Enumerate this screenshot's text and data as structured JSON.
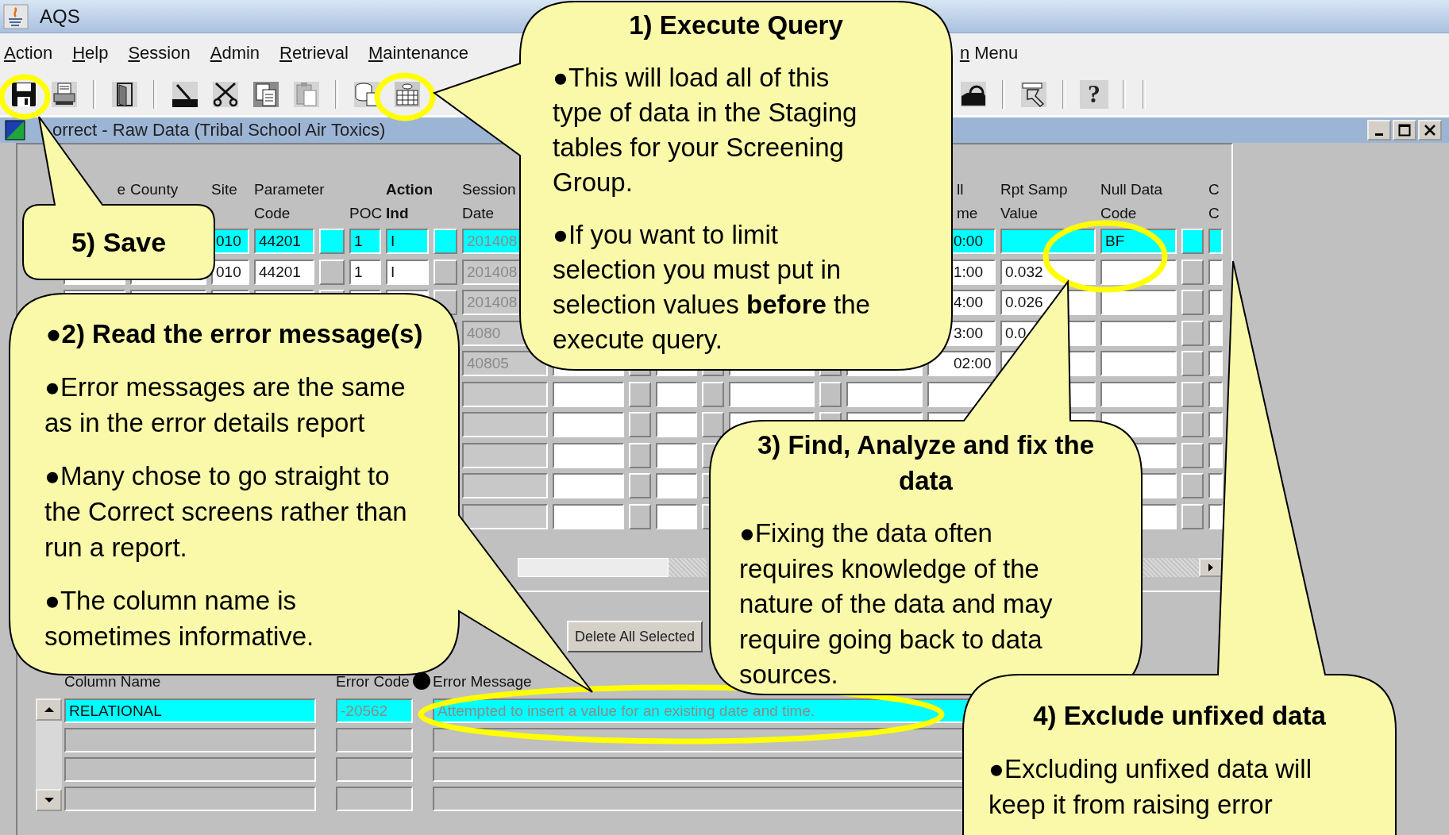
{
  "app": {
    "title": "AQS"
  },
  "menu": [
    {
      "label": "Action"
    },
    {
      "label": "Help"
    },
    {
      "label": "Session"
    },
    {
      "label": "Admin"
    },
    {
      "label": "Retrieval"
    },
    {
      "label": "Maintenance"
    },
    {
      "label": "n Menu"
    }
  ],
  "toolbar": {
    "left": [
      {
        "kind": "save"
      },
      {
        "kind": "print"
      },
      {
        "kind": "separator"
      },
      {
        "kind": "exit"
      },
      {
        "kind": "separator"
      },
      {
        "kind": "edit"
      },
      {
        "kind": "cut"
      },
      {
        "kind": "copy"
      },
      {
        "kind": "paste"
      },
      {
        "kind": "separator"
      },
      {
        "kind": "query"
      },
      {
        "kind": "execute"
      }
    ],
    "right": [
      {
        "kind": "tray"
      },
      {
        "kind": "separator"
      },
      {
        "kind": "flashlight"
      },
      {
        "kind": "separator"
      },
      {
        "kind": "help",
        "label": "?"
      },
      {
        "kind": "separator"
      },
      {
        "kind": "separator"
      }
    ]
  },
  "window": {
    "title": "orrect - Raw Data (Tribal School Air Toxics)"
  },
  "grid": {
    "columns": [
      {
        "top": "e"
      },
      {
        "top": "County"
      },
      {
        "top": "Site"
      },
      {
        "top": "Parameter",
        "bottom": "Code"
      },
      {
        "bottom": "POC"
      },
      {
        "top": "Action",
        "bottom": "Ind",
        "required": true
      },
      {
        "top": "Session",
        "bottom": "Date",
        "readonly": true
      },
      {
        "top": "ll",
        "bottom": "me"
      },
      {
        "top": "Rpt Samp",
        "bottom": "Value"
      },
      {
        "top": "Null Data",
        "bottom": "Code"
      },
      {
        "top": "C",
        "bottom": "C"
      }
    ],
    "rows": [
      {
        "selected": true,
        "site": "010",
        "parameter_code": "44201",
        "poc": "1",
        "action_ind": "I",
        "session_date": "201408",
        "time": "0:00",
        "null_data_code": "BF"
      },
      {
        "selected": false,
        "site": "010",
        "parameter_code": "44201",
        "poc": "1",
        "action_ind": "I",
        "session_date": "201408",
        "time": "1:00",
        "rpt_samp_value": "0.032"
      },
      {
        "selected": false,
        "session_date": "201408",
        "time": "4:00",
        "rpt_samp_value": "0.026"
      },
      {
        "selected": false,
        "session_date": "4080",
        "time": "3:00",
        "rpt_samp_value": "0.0"
      },
      {
        "selected": false,
        "session_date": "40805",
        "time": "02:00"
      }
    ]
  },
  "delete_button": {
    "label": "Delete All Selected"
  },
  "errors": {
    "columns": [
      {
        "label": "Column Name"
      },
      {
        "label": "Error Code",
        "readonly": true
      },
      {
        "label": "Error Message",
        "readonly": true
      }
    ],
    "rows": [
      {
        "selected": true,
        "column_name": "RELATIONAL",
        "error_code": "-20562",
        "message": "Attempted to insert a value for an existing date and time."
      }
    ]
  },
  "callouts": [
    {
      "title": "1) Execute Query",
      "paragraphs": [
        "●This will load all of this\ntype of data in the Staging\ntables for your Screening\nGroup.",
        "●If you want to limit\nselection you must put in\nselection values **before** the\nexecute query."
      ]
    },
    {
      "title": "5) Save"
    },
    {
      "title": "●2) Read the error message(s)",
      "paragraphs": [
        "●Error messages are the same\nas in the error details report",
        "●Many chose to go straight to\nthe Correct screens rather than\nrun a report.",
        "●The column name is\nsometimes informative."
      ]
    },
    {
      "title": "3) Find, Analyze and fix the\ndata",
      "paragraphs": [
        "●Fixing the data often\nrequires knowledge of the\nnature of the data and may\nrequire going back to data\nsources."
      ]
    },
    {
      "title": "4) Exclude unfixed data",
      "paragraphs": [
        "●Excluding unfixed data will\nkeep it from raising error"
      ]
    }
  ]
}
